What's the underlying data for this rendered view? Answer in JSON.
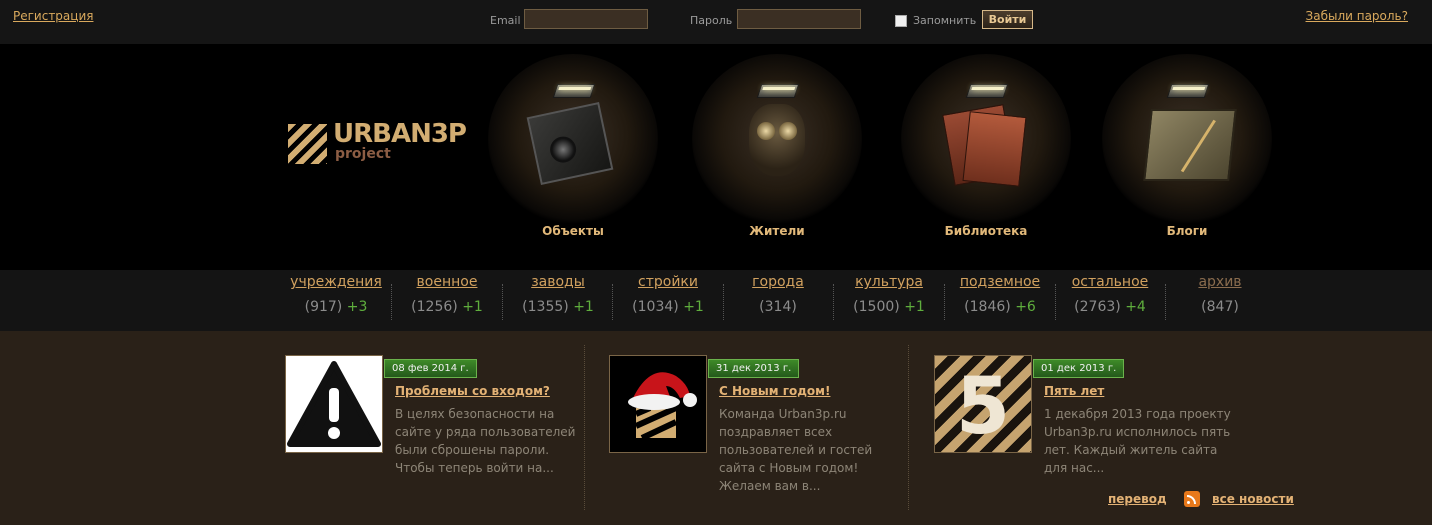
{
  "topbar": {
    "register": "Регистрация",
    "email_label": "Email",
    "password_label": "Пароль",
    "remember_label": "Запомнить",
    "login_button": "Войти",
    "forgot": "Забыли пароль?"
  },
  "logo": {
    "main": "URBAN3P",
    "sub": "project"
  },
  "categories": [
    {
      "label": "Объекты",
      "icon": "camera-icon"
    },
    {
      "label": "Жители",
      "icon": "gas-mask-icon"
    },
    {
      "label": "Библиотека",
      "icon": "books-icon"
    },
    {
      "label": "Блоги",
      "icon": "notebook-icon"
    }
  ],
  "stats": [
    {
      "label": "учреждения",
      "count": "(917)",
      "add": "+3"
    },
    {
      "label": "военное",
      "count": "(1256)",
      "add": "+1"
    },
    {
      "label": "заводы",
      "count": "(1355)",
      "add": "+1"
    },
    {
      "label": "стройки",
      "count": "(1034)",
      "add": "+1"
    },
    {
      "label": "города",
      "count": "(314)",
      "add": ""
    },
    {
      "label": "культура",
      "count": "(1500)",
      "add": "+1"
    },
    {
      "label": "подземное",
      "count": "(1846)",
      "add": "+6"
    },
    {
      "label": "остальное",
      "count": "(2763)",
      "add": "+4"
    },
    {
      "label": "архив",
      "count": "(847)",
      "add": ""
    }
  ],
  "news": [
    {
      "date": "08 фев 2014 г.",
      "title": "Проблемы со входом?",
      "text": "В целях безопасности на сайте у ряда пользователей были сброшены пароли. Чтобы теперь войти на..."
    },
    {
      "date": "31 дек 2013 г.",
      "title": "С Новым годом!",
      "text": "Команда Urban3p.ru поздравляет всех пользователей и гостей сайта с Новым годом! Желаем вам в..."
    },
    {
      "date": "01 дек 2013 г.",
      "title": "Пять лет",
      "text": "1 декабря 2013 года проекту Urban3p.ru исполнилось пять лет. Каждый житель сайта для нас...",
      "thumb_number": "5"
    }
  ],
  "footer": {
    "translate": "перевод",
    "all_news": "все новости"
  },
  "colors": {
    "accent": "#d9a95d",
    "green": "#5fae3d",
    "date_badge": "#2f7521"
  }
}
